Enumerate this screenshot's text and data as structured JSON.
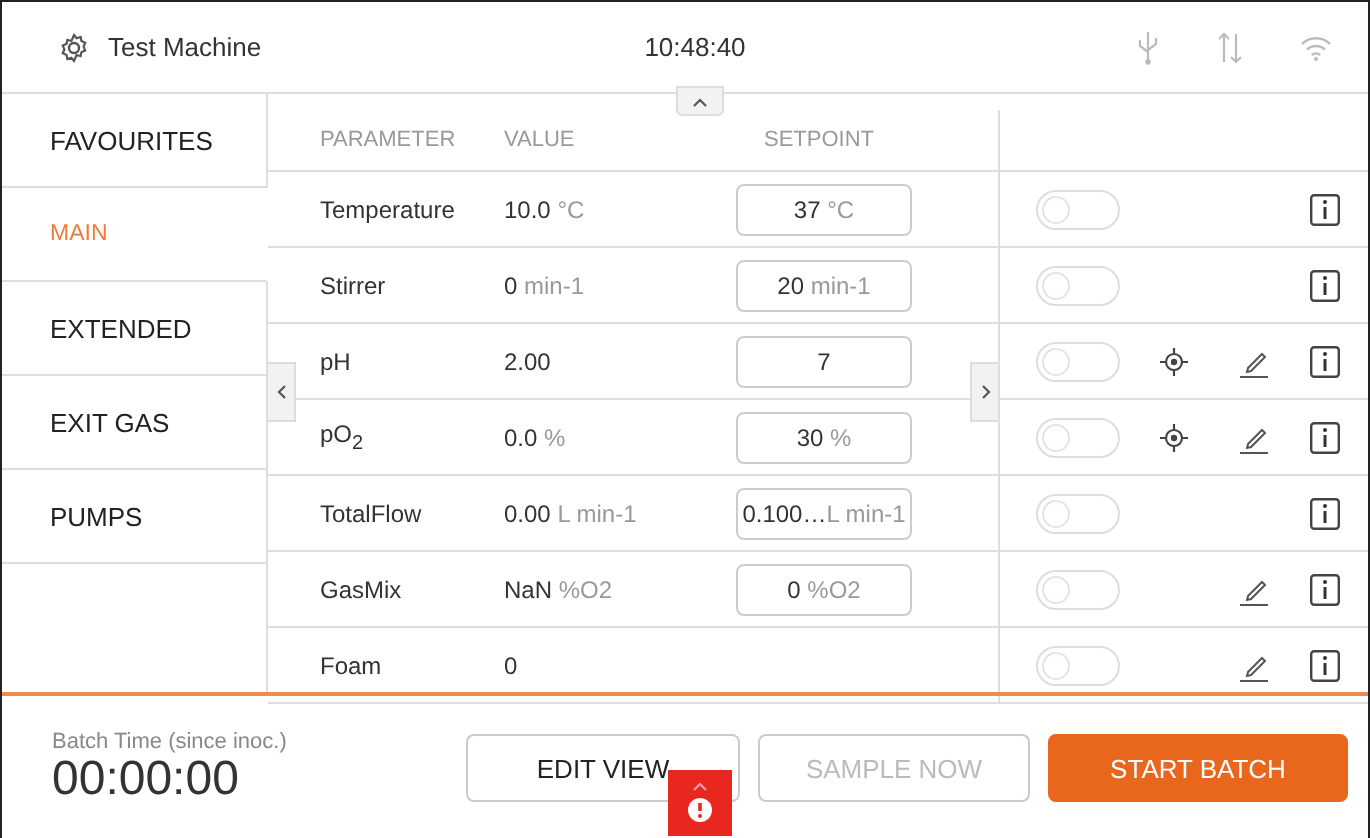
{
  "header": {
    "title": "Test Machine",
    "time": "10:48:40"
  },
  "sidebar": {
    "items": [
      {
        "label": "FAVOURITES",
        "selected": false
      },
      {
        "label": "MAIN",
        "selected": true
      },
      {
        "label": "EXTENDED",
        "selected": false
      },
      {
        "label": "EXIT GAS",
        "selected": false
      },
      {
        "label": "PUMPS",
        "selected": false
      }
    ]
  },
  "table": {
    "columns": [
      "PARAMETER",
      "VALUE",
      "SETPOINT"
    ],
    "rows": [
      {
        "parameter": "Temperature",
        "value": "10.0",
        "unit": "°C",
        "setpoint": {
          "value": "37",
          "unit": "°C"
        },
        "on": false,
        "target": false,
        "edit": false
      },
      {
        "parameter": "Stirrer",
        "value": "0",
        "unit": "min-1",
        "setpoint": {
          "value": "20",
          "unit": "min-1"
        },
        "on": false,
        "target": false,
        "edit": false
      },
      {
        "parameter": "pH",
        "value": "2.00",
        "setpoint": {
          "value": "7"
        },
        "on": false,
        "target": true,
        "edit": true
      },
      {
        "parameter": "pO$_{2}$",
        "value": "0.0",
        "unit": "%",
        "setpoint": {
          "value": "30",
          "unit": "%"
        },
        "on": false,
        "target": true,
        "edit": true
      },
      {
        "parameter": "TotalFlow",
        "value": "0.00",
        "unit": "L min-1",
        "setpoint": {
          "value": "0.100…",
          "unit": "L min-1"
        },
        "on": false,
        "target": false,
        "edit": false
      },
      {
        "parameter": "GasMix",
        "value": "NaN",
        "unit": "%O2",
        "setpoint": {
          "value": "0",
          "unit": "%O2"
        },
        "on": false,
        "target": false,
        "edit": true
      },
      {
        "parameter": "Foam",
        "value": "0",
        "on": false,
        "target": false,
        "edit": true
      }
    ]
  },
  "footer": {
    "batch_label": "Batch Time (since inoc.)",
    "batch_time": "00:00:00",
    "buttons": [
      {
        "label": "EDIT VIEW",
        "kind": "outline"
      },
      {
        "label": "SAMPLE NOW",
        "kind": "disabled"
      },
      {
        "label": "START BATCH",
        "kind": "primary"
      }
    ]
  }
}
